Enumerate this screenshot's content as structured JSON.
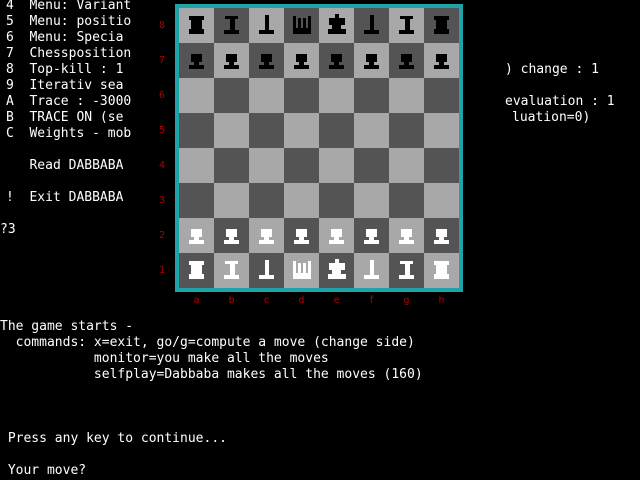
{
  "menu_lines": [
    "4  Menu: Variant",
    "5  Menu: positio",
    "6  Menu: Specia",
    "7  Chessposition",
    "8  Top-kill : 1",
    "9  Iterativ sea",
    "A  Trace : -3000",
    "B  TRACE ON (se",
    "C  Weights - mob"
  ],
  "read_line": "   Read DABBABA",
  "exit_line": "!  Exit DABBABA",
  "prompt_line": "?3",
  "right_fragments": [
    ") change : 1",
    "evaluation : 1",
    "luation=0)"
  ],
  "board": {
    "ranks": [
      "8",
      "7",
      "6",
      "5",
      "4",
      "3",
      "2",
      "1"
    ],
    "files": [
      "a",
      "b",
      "c",
      "d",
      "e",
      "f",
      "g",
      "h"
    ],
    "position": [
      [
        "bR",
        "bN",
        "bB",
        "bQ",
        "bK",
        "bB",
        "bN",
        "bR"
      ],
      [
        "bP",
        "bP",
        "bP",
        "bP",
        "bP",
        "bP",
        "bP",
        "bP"
      ],
      [
        "",
        "",
        "",
        "",
        "",
        "",
        "",
        ""
      ],
      [
        "",
        "",
        "",
        "",
        "",
        "",
        "",
        ""
      ],
      [
        "",
        "",
        "",
        "",
        "",
        "",
        "",
        ""
      ],
      [
        "",
        "",
        "",
        "",
        "",
        "",
        "",
        ""
      ],
      [
        "wP",
        "wP",
        "wP",
        "wP",
        "wP",
        "wP",
        "wP",
        "wP"
      ],
      [
        "wR",
        "wN",
        "wB",
        "wQ",
        "wK",
        "wB",
        "wN",
        "wR"
      ]
    ],
    "colors": {
      "frame": "#1fa3a8",
      "light_square": "#a8a8a8",
      "dark_square": "#545454",
      "white_piece": "#ffffff",
      "black_piece": "#000000",
      "label": "#b00000"
    }
  },
  "game_starts": "The game starts -",
  "commands": [
    "  commands: x=exit, go/g=compute a move (change side)",
    "            monitor=you make all the moves",
    "            selfplay=Dabbaba makes all the moves (160)"
  ],
  "press_key": " Press any key to continue...",
  "your_move": " Your move?"
}
